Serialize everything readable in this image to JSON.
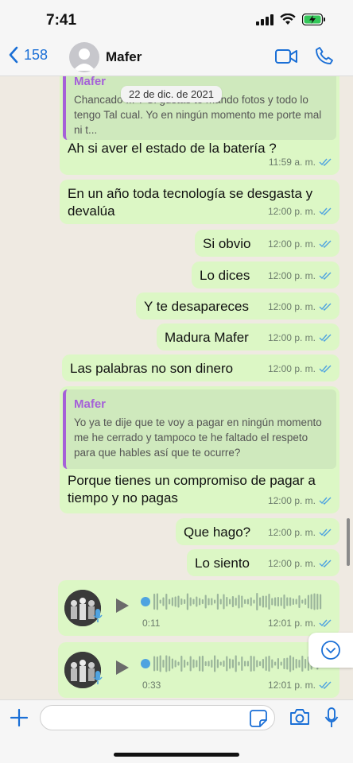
{
  "status_bar": {
    "time": "7:41"
  },
  "header": {
    "back_count": "158",
    "contact_name": "Mafer"
  },
  "date_chip": "22 de dic. de 2021",
  "messages": [
    {
      "quote_author": "Mafer",
      "quote_text": "Chancado ... ? Si gustas te mando fotos y todo lo tengo Tal cual. Yo en ningún momento me porte mal ni t...",
      "text": "Ah si aver el estado de la batería ?",
      "time": "11:59 a. m."
    },
    {
      "text": "En un año toda tecnología se desgasta y devalúa",
      "time": "12:00 p. m."
    },
    {
      "text": "Si obvio",
      "time": "12:00 p. m."
    },
    {
      "text": "Lo dices",
      "time": "12:00 p. m."
    },
    {
      "text": "Y te desapareces",
      "time": "12:00 p. m."
    },
    {
      "text": "Madura Mafer",
      "time": "12:00 p. m."
    },
    {
      "text": "Las palabras no son dinero",
      "time": "12:00 p. m."
    },
    {
      "quote_author": "Mafer",
      "quote_text": "Yo ya te dije que te voy a pagar en ningún momento me he cerrado y tampoco te he faltado el respeto para que hables así que te ocurre?",
      "text": "Porque tienes un compromiso de pagar a tiempo y no pagas",
      "time": "12:00 p. m."
    },
    {
      "text": "Que hago?",
      "time": "12:00 p. m."
    },
    {
      "text": "Lo siento",
      "time": "12:00 p. m."
    },
    {
      "duration": "0:11",
      "time": "12:01 p. m."
    },
    {
      "duration": "0:33",
      "time": "12:01 p. m."
    }
  ],
  "input": {
    "value": ""
  },
  "colors": {
    "outgoing_bubble": "#dcf7c5",
    "ios_blue": "#1a6fd6",
    "quote_accent": "#a561d8",
    "read_ticks": "#4fa3e0"
  }
}
